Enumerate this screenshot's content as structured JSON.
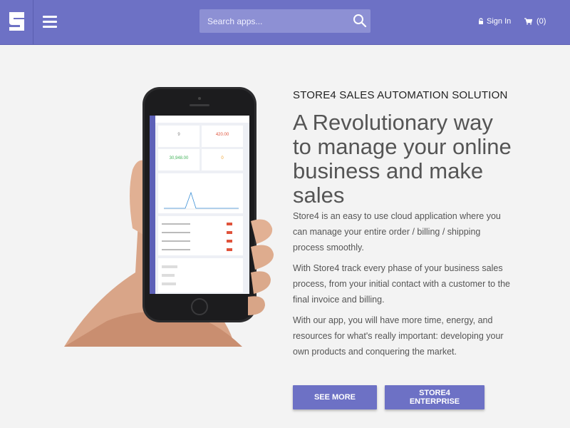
{
  "header": {
    "search_placeholder": "Search apps...",
    "signin_label": "Sign In",
    "cart_label": "(0)",
    "brand_color": "#6d71c5"
  },
  "hero": {
    "eyebrow": "STORE4 SALES AUTOMATION SOLUTION",
    "headline": "A Revolutionary way to manage your online business and make sales",
    "paragraphs": [
      "Store4 is an easy to use cloud application where you can manage your entire order / billing / shipping process smoothly.",
      "With Store4 track every phase of your business sales process, from your initial contact with a customer to the final invoice and billing.",
      "With our app, you will have more time, energy, and resources for what's really important: developing your own products and conquering the market."
    ],
    "buttons": {
      "see_more": "SEE MORE",
      "enterprise": "STORE4 ENTERPRISE"
    }
  },
  "phone_screen": {
    "stat1": "9",
    "stat2": "420.00",
    "stat3": "30,948.00",
    "stat4": "0"
  }
}
